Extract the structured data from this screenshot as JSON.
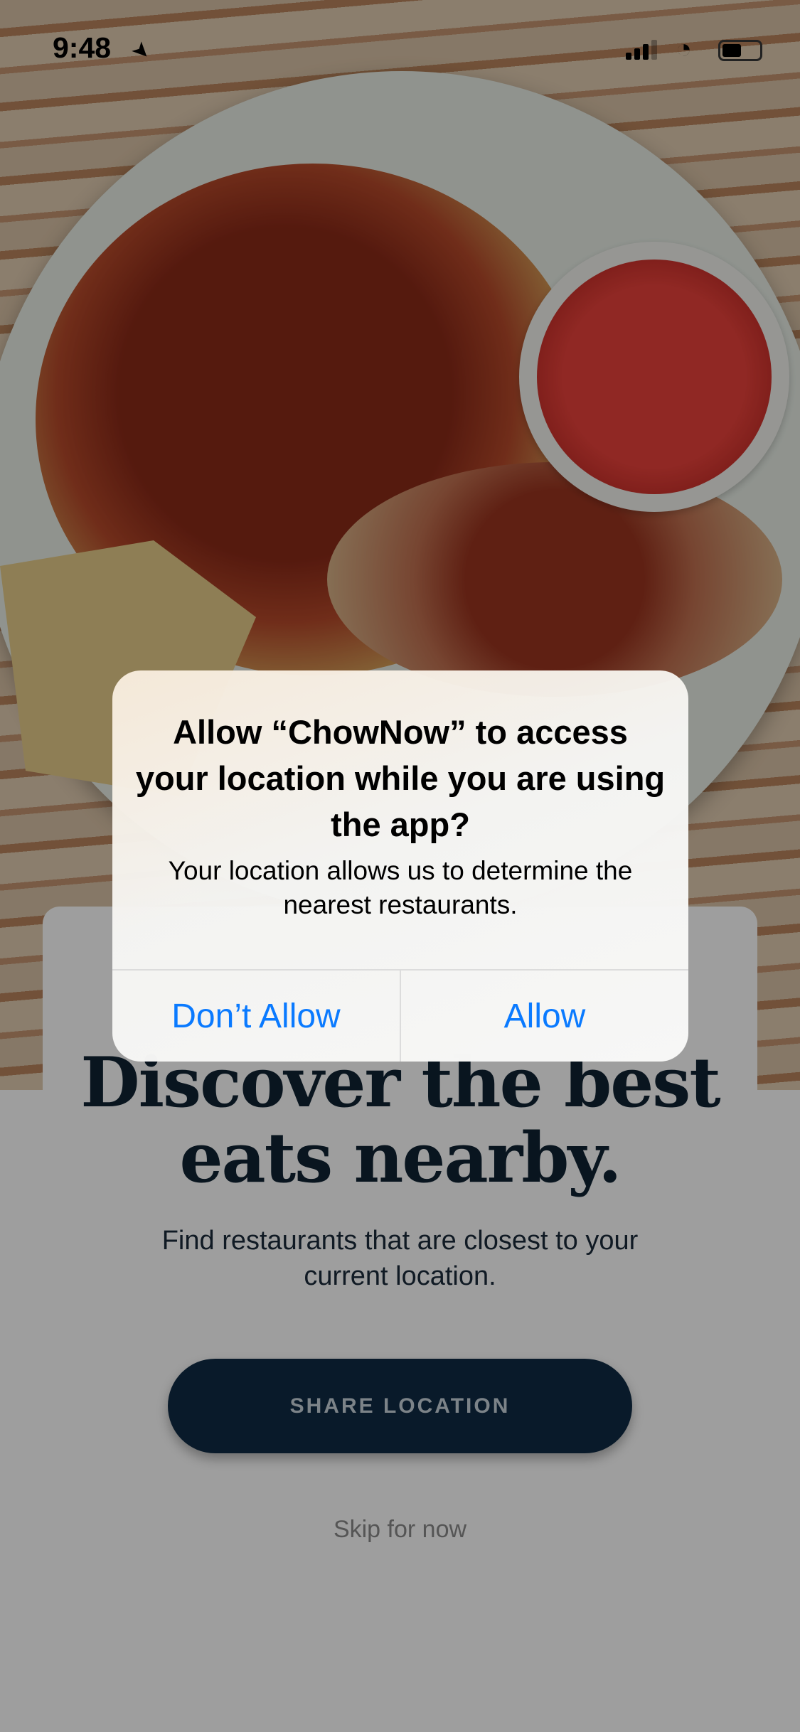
{
  "status_bar": {
    "time": "9:48",
    "location_icon": "location-arrow-icon",
    "signal_icon": "cellular-signal-icon",
    "wifi_icon": "wifi-icon",
    "battery_icon": "battery-icon"
  },
  "onboarding": {
    "heading_line1": "Discover the best",
    "heading_line2": "eats nearby.",
    "subtitle": "Find restaurants that are closest to your current location.",
    "share_button": "SHARE LOCATION",
    "skip_link": "Skip for now"
  },
  "alert": {
    "title": "Allow “ChowNow” to access your location while you are using the app?",
    "message": "Your location allows us to determine the nearest restaurants.",
    "deny_button": "Don’t Allow",
    "allow_button": "Allow",
    "button_color": "#0a7aff"
  }
}
